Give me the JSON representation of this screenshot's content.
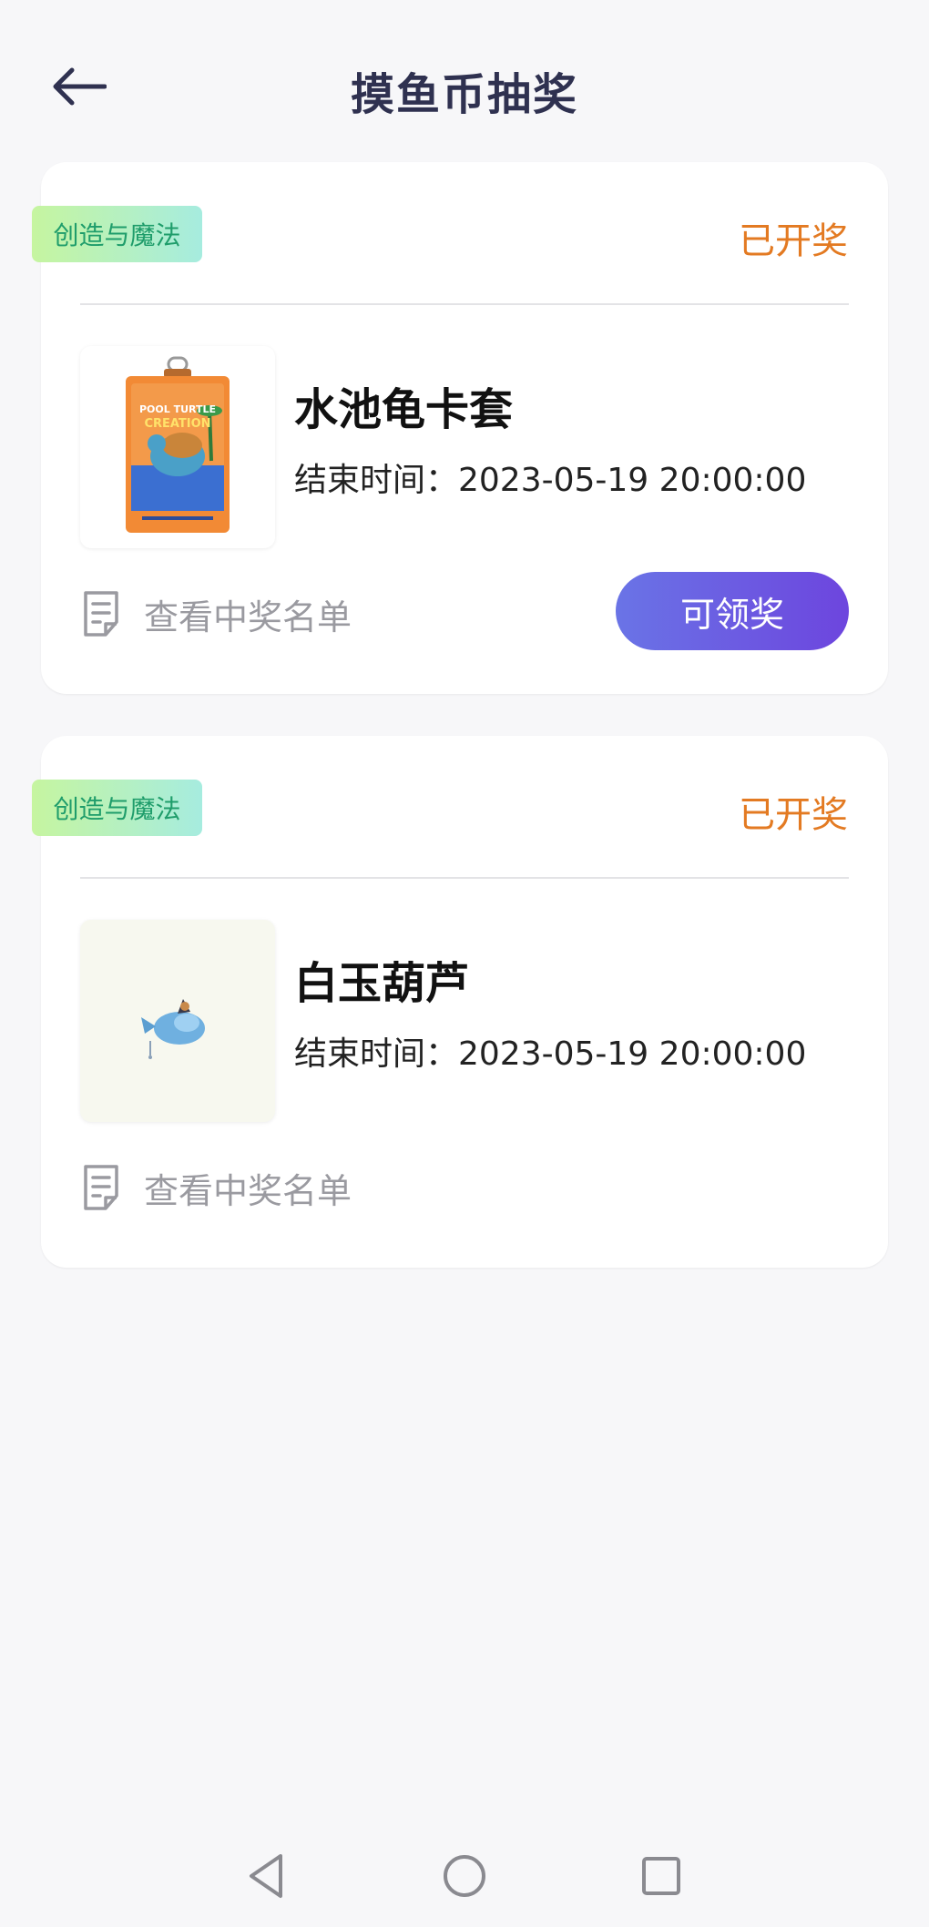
{
  "header": {
    "title": "摸鱼币抽奖",
    "back_icon": "arrow-left-icon"
  },
  "cards": [
    {
      "tag": "创造与魔法",
      "status": "已开奖",
      "prize_name": "水池龟卡套",
      "end_time": "结束时间：2023-05-19 20:00:00",
      "winners_label": "查看中奖名单",
      "claim_label": "可领奖",
      "image_text": "POOL TURTLE CREATION"
    },
    {
      "tag": "创造与魔法",
      "status": "已开奖",
      "prize_name": "白玉葫芦",
      "end_time": "结束时间：2023-05-19 20:00:00",
      "winners_label": "查看中奖名单"
    }
  ],
  "colors": {
    "status": "#e37a22",
    "title": "#2f3150",
    "tag_text": "#1f9d6b",
    "button_start": "#6a74e6",
    "button_end": "#6d45de"
  },
  "system_nav": {
    "back_icon": "triangle-back-icon",
    "home_icon": "circle-home-icon",
    "recent_icon": "square-recent-icon"
  }
}
